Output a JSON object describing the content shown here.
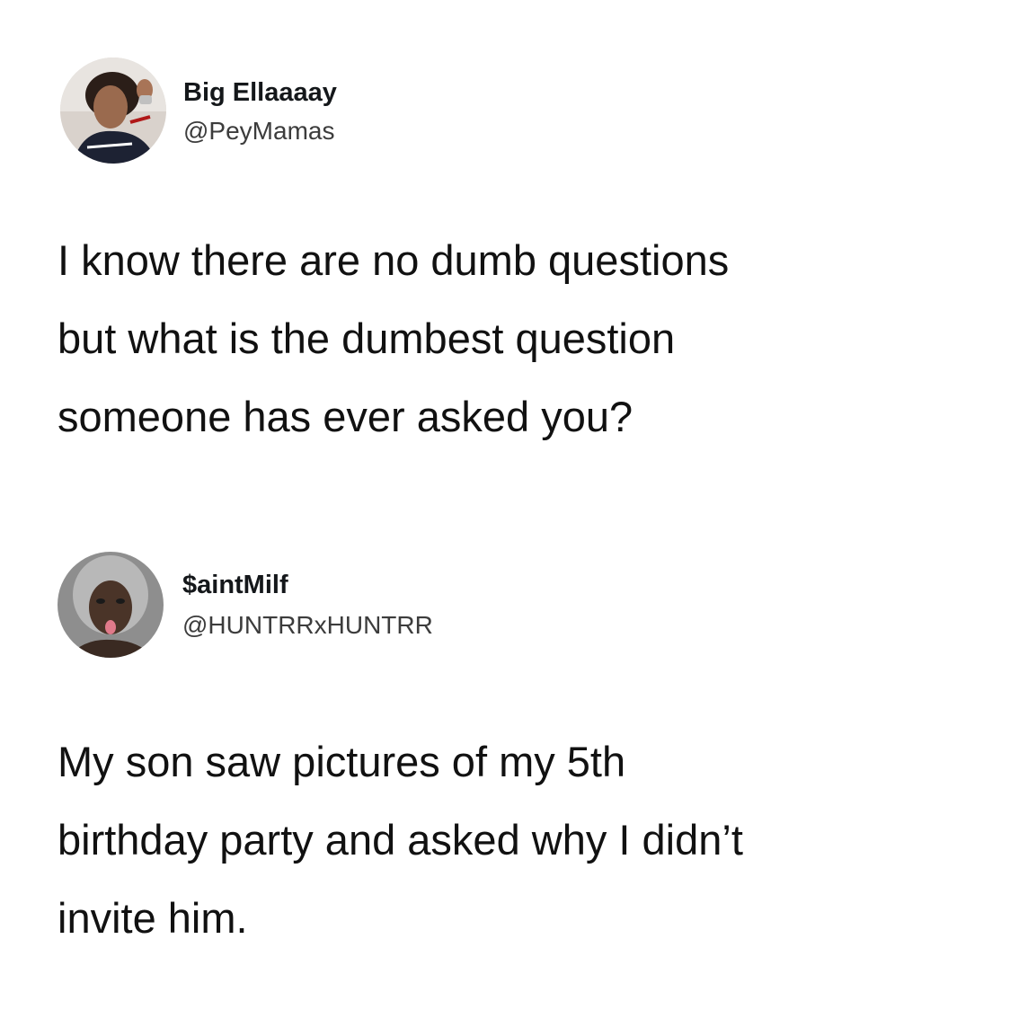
{
  "tweets": [
    {
      "name": "Big Ellaaaay",
      "handle": "@PeyMamas",
      "avatar_icon": "profile-photo-avatar",
      "text_lines": [
        "I know there are no dumb questions",
        "but what is the dumbest question",
        "someone has ever asked you?"
      ]
    },
    {
      "name": "$aintMilf",
      "handle": "@HUNTRRxHUNTRR",
      "avatar_icon": "profile-photo-avatar",
      "text_lines": [
        "My son saw pictures of my 5th",
        "birthday party and asked why I didn’t",
        "invite him."
      ]
    }
  ],
  "colors": {
    "background": "#ffffff",
    "text": "#14171a",
    "handle": "#3c3c3c"
  }
}
